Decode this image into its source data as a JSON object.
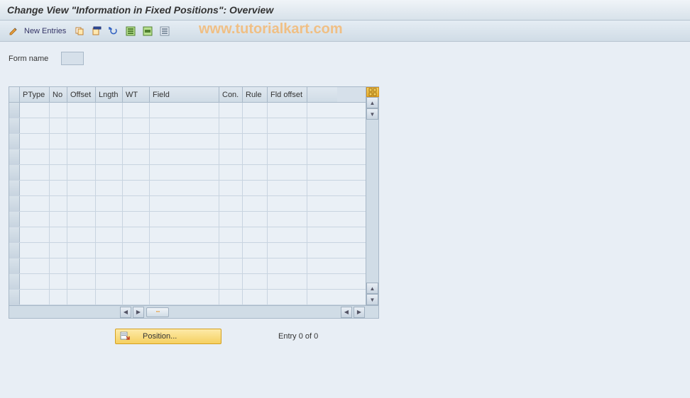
{
  "title": "Change View \"Information in Fixed Positions\": Overview",
  "toolbar": {
    "new_entries": "New Entries"
  },
  "watermark": "www.tutorialkart.com",
  "form": {
    "name_label": "Form name",
    "name_value": ""
  },
  "table": {
    "columns": {
      "ptype": "PType",
      "no": "No",
      "offset": "Offset",
      "lngth": "Lngth",
      "wt": "WT",
      "field": "Field",
      "con": "Con.",
      "rule": "Rule",
      "fldoffset": "Fld offset"
    },
    "rows": [
      {
        "ptype": "",
        "no": "",
        "offset": "",
        "lngth": "",
        "wt": "",
        "field": "",
        "con": "",
        "rule": "",
        "fldoffset": ""
      },
      {
        "ptype": "",
        "no": "",
        "offset": "",
        "lngth": "",
        "wt": "",
        "field": "",
        "con": "",
        "rule": "",
        "fldoffset": ""
      },
      {
        "ptype": "",
        "no": "",
        "offset": "",
        "lngth": "",
        "wt": "",
        "field": "",
        "con": "",
        "rule": "",
        "fldoffset": ""
      },
      {
        "ptype": "",
        "no": "",
        "offset": "",
        "lngth": "",
        "wt": "",
        "field": "",
        "con": "",
        "rule": "",
        "fldoffset": ""
      },
      {
        "ptype": "",
        "no": "",
        "offset": "",
        "lngth": "",
        "wt": "",
        "field": "",
        "con": "",
        "rule": "",
        "fldoffset": ""
      },
      {
        "ptype": "",
        "no": "",
        "offset": "",
        "lngth": "",
        "wt": "",
        "field": "",
        "con": "",
        "rule": "",
        "fldoffset": ""
      },
      {
        "ptype": "",
        "no": "",
        "offset": "",
        "lngth": "",
        "wt": "",
        "field": "",
        "con": "",
        "rule": "",
        "fldoffset": ""
      },
      {
        "ptype": "",
        "no": "",
        "offset": "",
        "lngth": "",
        "wt": "",
        "field": "",
        "con": "",
        "rule": "",
        "fldoffset": ""
      },
      {
        "ptype": "",
        "no": "",
        "offset": "",
        "lngth": "",
        "wt": "",
        "field": "",
        "con": "",
        "rule": "",
        "fldoffset": ""
      },
      {
        "ptype": "",
        "no": "",
        "offset": "",
        "lngth": "",
        "wt": "",
        "field": "",
        "con": "",
        "rule": "",
        "fldoffset": ""
      },
      {
        "ptype": "",
        "no": "",
        "offset": "",
        "lngth": "",
        "wt": "",
        "field": "",
        "con": "",
        "rule": "",
        "fldoffset": ""
      },
      {
        "ptype": "",
        "no": "",
        "offset": "",
        "lngth": "",
        "wt": "",
        "field": "",
        "con": "",
        "rule": "",
        "fldoffset": ""
      },
      {
        "ptype": "",
        "no": "",
        "offset": "",
        "lngth": "",
        "wt": "",
        "field": "",
        "con": "",
        "rule": "",
        "fldoffset": ""
      }
    ]
  },
  "footer": {
    "position_label": "Position...",
    "entry_text": "Entry 0 of 0"
  }
}
